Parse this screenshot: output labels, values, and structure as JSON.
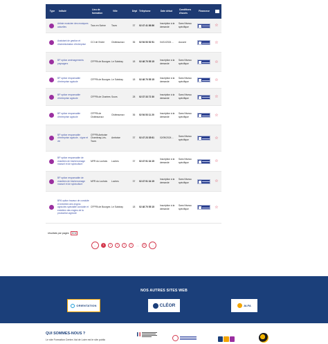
{
  "table": {
    "headers": {
      "type": "Type",
      "title": "Intitulé",
      "lieu": "Lieu de formation",
      "ville": "Ville",
      "dept": "Dépt",
      "tel": "Téléphone",
      "date": "Date début",
      "cond": "Conditions d'accès",
      "fin": "Financeur",
      "fav_icon": "folder-icon"
    },
    "rows": [
      {
        "title": "Artiste musicien des musiques actuelles",
        "lieu": "Tous en Scène",
        "ville": "Tours",
        "dept": "37",
        "tel": "02 47 41 86 86",
        "date": "Inscription à la demande",
        "cond": "Sans Niveau spécifique"
      },
      {
        "title": "Assistant de gestion et d'administration d'entreprise",
        "lieu": "CCI de l'Indre",
        "ville": "Châteauroux",
        "dept": "36",
        "tel": "02 54 53 52 51",
        "date": "04/11/2024 ...",
        "cond": "Aucune"
      },
      {
        "title": "BP option aménagements paysagers",
        "lieu": "CFPPA de Bourges",
        "ville": "Le Subdray",
        "dept": "18",
        "tel": "02 48 70 55 15",
        "date": "Inscription à la demande",
        "cond": "Sans Niveau spécifique"
      },
      {
        "title": "BP option responsable d'entreprise agricole",
        "lieu": "CFPPA de Bourges",
        "ville": "Le Subdray",
        "dept": "18",
        "tel": "02 48 70 55 15",
        "date": "Inscription à la demande",
        "cond": "Sans Niveau spécifique"
      },
      {
        "title": "BP option responsable d'entreprise agricole",
        "lieu": "CFPPA de Chartres",
        "ville": "Sours",
        "dept": "28",
        "tel": "02 37 33 72 30",
        "date": "Inscription à la demande",
        "cond": "Sans Niveau spécifique"
      },
      {
        "title": "BP option responsable d'entreprise agricole",
        "lieu": "CFPPA de Châteauroux",
        "ville": "Châteauroux",
        "dept": "36",
        "tel": "02 54 53 11 20",
        "date": "Inscription à la demande",
        "cond": "Sans Niveau spécifique"
      },
      {
        "title": "BP option responsable d'entreprise agricole - vigne et vin",
        "lieu": "CFPPA Amboise Chambray-Lès-Tours",
        "ville": "Amboise",
        "dept": "37",
        "tel": "02 47 23 35 61",
        "date": "02/09/2024 ...",
        "cond": "Sans Niveau spécifique"
      },
      {
        "title": "BP option responsable de chantiers de bûcheronnage manuel et de sylviculture",
        "lieu": "MFR du Lochois",
        "ville": "Loches",
        "dept": "37",
        "tel": "02 47 91 34 15",
        "date": "Inscription à la demande",
        "cond": "Sans Niveau spécifique"
      },
      {
        "title": "BP option responsable de chantiers de bûcheronnage manuel et de sylviculture",
        "lieu": "MFR du Lochois",
        "ville": "Loches",
        "dept": "37",
        "tel": "02 47 91 34 15",
        "date": "Inscription à la demande",
        "cond": "Sans Niveau spécifique"
      },
      {
        "title": "BPA option travaux de conduite et entretien des engins agricoles spécialité conduite et entretien des engins de la production agricole",
        "lieu": "CFPPA de Bourges",
        "ville": "Le Subdray",
        "dept": "18",
        "tel": "02 48 70 55 15",
        "date": "Inscription à la demande",
        "cond": "Sans Niveau spécifique"
      }
    ]
  },
  "perpage": {
    "label": "résultats par pages",
    "value": "10"
  },
  "pagination": {
    "prev": "←",
    "pages": [
      "1",
      "2",
      "3",
      "4",
      "5"
    ],
    "active": "1",
    "dots": "...",
    "last": "16",
    "next": "→"
  },
  "band": {
    "title": "NOS AUTRES SITES WEB",
    "partners": {
      "orientation": "ORIENTATION",
      "cleor": "CLÉOR",
      "alfa": "ALFA"
    }
  },
  "footer": {
    "title": "QUI SOMMES-NOUS ?",
    "text": "Le site Formation Centre-Val de Loire est le site public"
  },
  "colors": {
    "header_bg": "#1e3a72",
    "type_dot": "#9b2fa0",
    "accent": "#d43a4f",
    "band_bg": "#1b3f7a"
  }
}
